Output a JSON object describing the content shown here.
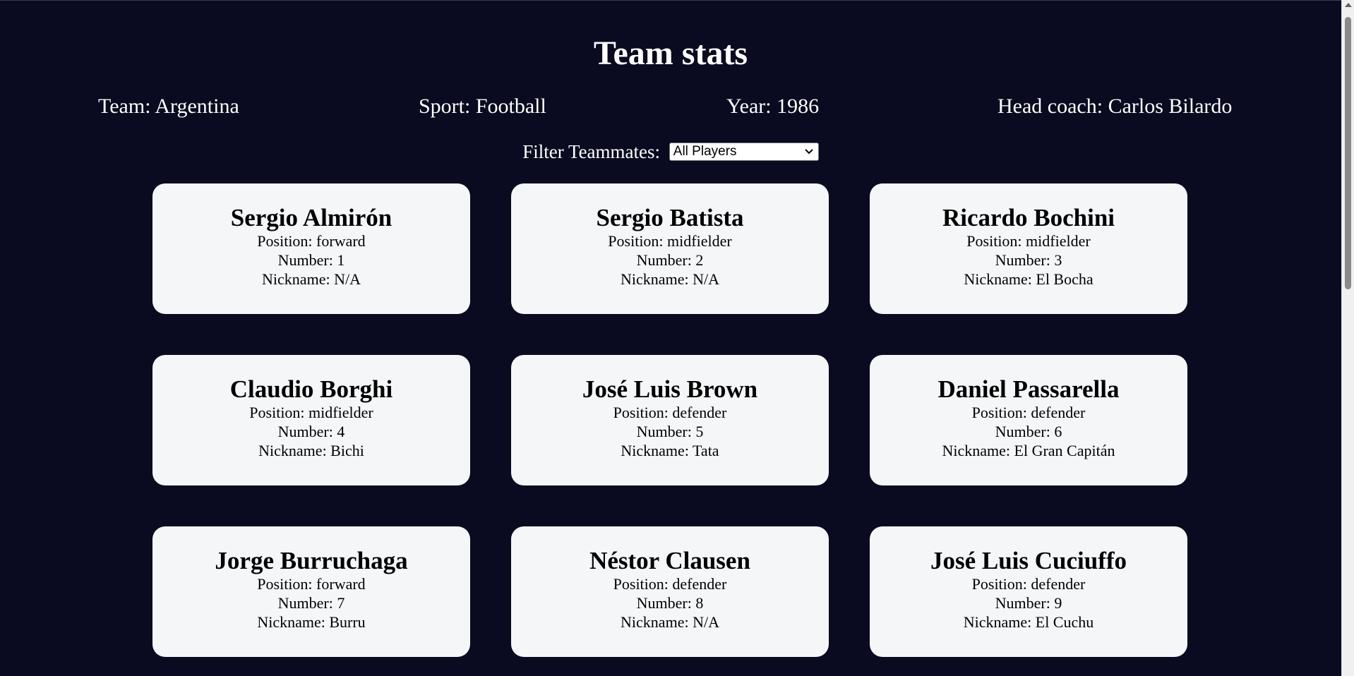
{
  "header": {
    "title": "Team stats",
    "team": "Team: Argentina",
    "sport": "Sport: Football",
    "year": "Year: 1986",
    "coach": "Head coach: Carlos Bilardo"
  },
  "filter": {
    "label": "Filter Teammates:",
    "selected": "All Players",
    "icon": "chevron-down-icon"
  },
  "players": [
    {
      "name": "Sergio Almirón",
      "position": "Position: forward",
      "number": "Number: 1",
      "nickname": "Nickname: N/A"
    },
    {
      "name": "Sergio Batista",
      "position": "Position: midfielder",
      "number": "Number: 2",
      "nickname": "Nickname: N/A"
    },
    {
      "name": "Ricardo Bochini",
      "position": "Position: midfielder",
      "number": "Number: 3",
      "nickname": "Nickname: El Bocha"
    },
    {
      "name": "Claudio Borghi",
      "position": "Position: midfielder",
      "number": "Number: 4",
      "nickname": "Nickname: Bichi"
    },
    {
      "name": "José Luis Brown",
      "position": "Position: defender",
      "number": "Number: 5",
      "nickname": "Nickname: Tata"
    },
    {
      "name": "Daniel Passarella",
      "position": "Position: defender",
      "number": "Number: 6",
      "nickname": "Nickname: El Gran Capitán"
    },
    {
      "name": "Jorge Burruchaga",
      "position": "Position: forward",
      "number": "Number: 7",
      "nickname": "Nickname: Burru"
    },
    {
      "name": "Néstor Clausen",
      "position": "Position: defender",
      "number": "Number: 8",
      "nickname": "Nickname: N/A"
    },
    {
      "name": "José Luis Cuciuffo",
      "position": "Position: defender",
      "number": "Number: 9",
      "nickname": "Nickname: El Cuchu"
    }
  ],
  "colors": {
    "background": "#0a0a20",
    "card": "#f4f6f8"
  }
}
